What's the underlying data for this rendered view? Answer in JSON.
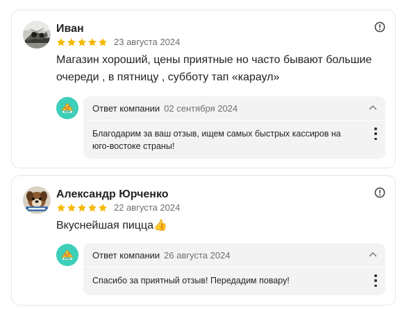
{
  "colors": {
    "star": "#f5b900",
    "company_avatar_bg": "#3ecfb8",
    "answer_bg": "#f3f3f3",
    "muted_text": "#6e6e6e"
  },
  "reviews": [
    {
      "author": "Иван",
      "rating": 5,
      "date": "23 августа 2024",
      "text": "Магазин хороший, цены приятные но часто бывают большие очереди , в пятницу , субботу тап «караул»",
      "report_icon": "exclamation-circle-icon",
      "response": {
        "label": "Ответ компании",
        "date": "02 сентября 2024",
        "text": "Благодарим за ваш отзыв, ищем самых быстрых кассиров на юго-востоке страны!",
        "toggle_icon": "chevron-up-icon",
        "menu_icon": "kebab-menu-icon"
      }
    },
    {
      "author": "Александр Юрченко",
      "rating": 5,
      "date": "22 августа 2024",
      "text": "Вкуснейшая пицца👍",
      "report_icon": "exclamation-circle-icon",
      "response": {
        "label": "Ответ компании",
        "date": "26 августа 2024",
        "text": "Спасибо за приятный отзыв! Передадим повару!",
        "toggle_icon": "chevron-up-icon",
        "menu_icon": "kebab-menu-icon"
      }
    }
  ]
}
